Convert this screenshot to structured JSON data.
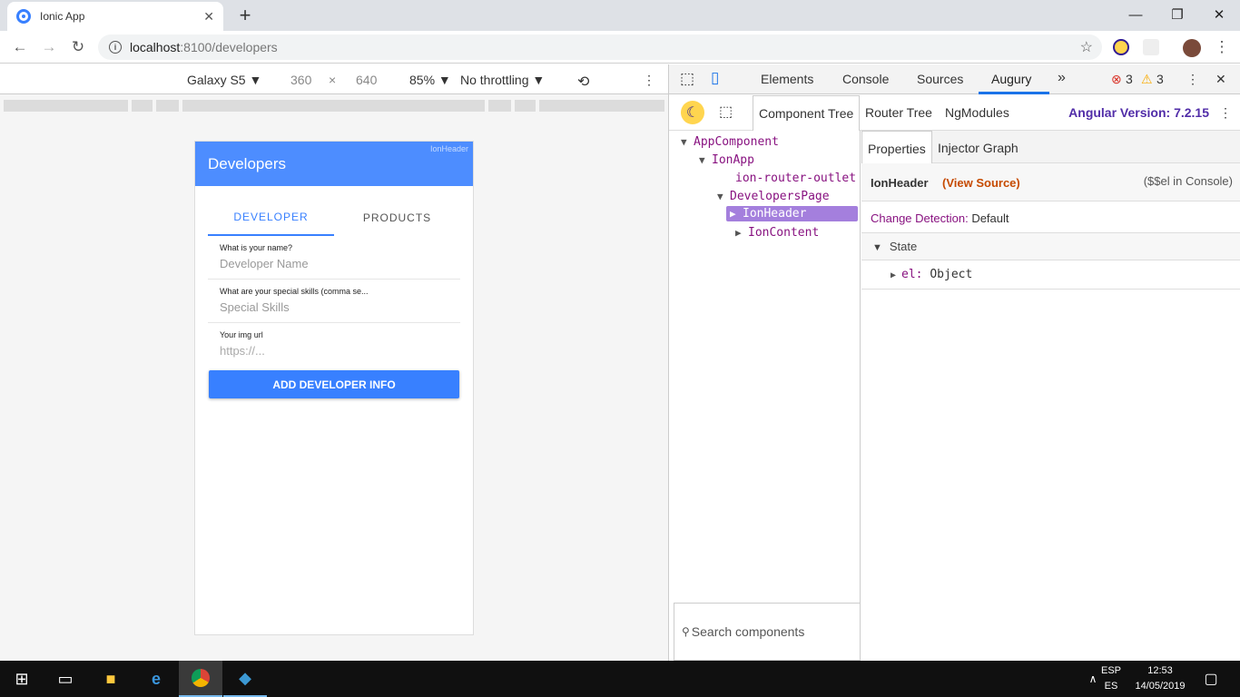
{
  "browser": {
    "tab_title": "Ionic App",
    "tab_close": "✕",
    "new_tab": "+",
    "url_host": "localhost",
    "url_path": ":8100/developers",
    "window_controls": {
      "minimize": "—",
      "maximize": "❐",
      "close": "✕"
    }
  },
  "device_toolbar": {
    "device": "Galaxy S5 ▼",
    "width": "360",
    "times": "×",
    "height": "640",
    "zoom": "85% ▼",
    "throttling": "No throttling ▼"
  },
  "phone": {
    "header_title": "Developers",
    "header_hint": "IonHeader",
    "segments": [
      "DEVELOPER",
      "PRODUCTS"
    ],
    "fields": [
      {
        "label": "What is your name?",
        "placeholder": "Developer Name"
      },
      {
        "label": "What are your special skills (comma se...",
        "placeholder": "Special Skills"
      },
      {
        "label": "Your img url",
        "placeholder": "https://..."
      }
    ],
    "button": "ADD DEVELOPER INFO"
  },
  "devtools": {
    "tabs": [
      "Elements",
      "Console",
      "Sources",
      "Augury"
    ],
    "more": "»",
    "errors": "3",
    "warnings": "3",
    "augury_tabs": [
      "Component Tree",
      "Router Tree",
      "NgModules"
    ],
    "angular_version": "Angular Version: 7.2.15",
    "tree": {
      "nodes": [
        "AppComponent",
        "IonApp",
        "ion-router-outlet",
        "DevelopersPage",
        "IonHeader",
        "IonContent"
      ],
      "search_placeholder": "Search components"
    },
    "properties": {
      "tabs": [
        "Properties",
        "Injector Graph"
      ],
      "component": "IonHeader",
      "view_source": "(View Source)",
      "console_hint": "($$el in Console)",
      "change_detection_label": "Change Detection:",
      "change_detection_value": "Default",
      "state_label": "State",
      "state_key": "el:",
      "state_value": "Object"
    }
  },
  "taskbar": {
    "lang_top": "ESP",
    "lang_bottom": "ES",
    "time": "12:53",
    "date": "14/05/2019"
  },
  "colors": {
    "ionic_primary": "#3880ff",
    "augury_purple": "#512da8",
    "tree_selected": "#a47fdd"
  }
}
